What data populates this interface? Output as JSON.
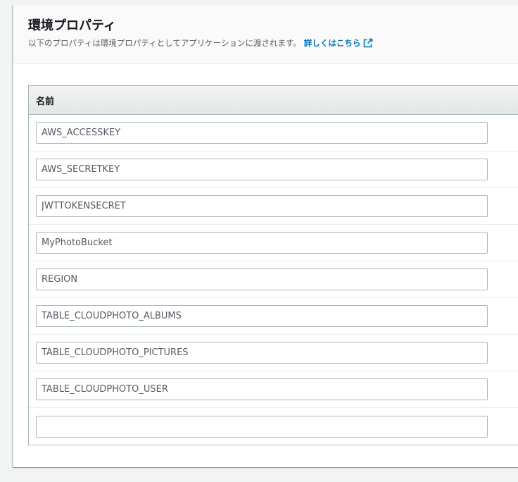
{
  "header": {
    "title": "環境プロパティ",
    "description": "以下のプロパティは環境プロパティとしてアプリケーションに渡されます。",
    "learn_more": "詳しくはこちら"
  },
  "table": {
    "column_name": "名前",
    "rows": [
      {
        "name": "AWS_ACCESSKEY"
      },
      {
        "name": "AWS_SECRETKEY"
      },
      {
        "name": "JWTTOKENSECRET"
      },
      {
        "name": "MyPhotoBucket"
      },
      {
        "name": "REGION"
      },
      {
        "name": "TABLE_CLOUDPHOTO_ALBUMS"
      },
      {
        "name": "TABLE_CLOUDPHOTO_PICTURES"
      },
      {
        "name": "TABLE_CLOUDPHOTO_USER"
      },
      {
        "name": ""
      }
    ]
  },
  "colors": {
    "link": "#0073bb",
    "border": "#aab7b8"
  },
  "icons": {
    "learn_more": "external-link-icon"
  }
}
